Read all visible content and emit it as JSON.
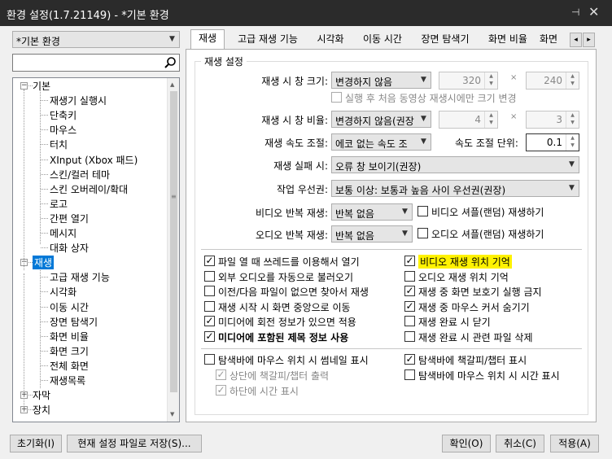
{
  "window": {
    "title": "환경 설정(1.7.21149) - *기본 환경",
    "pin_glyph": "⊣",
    "close_glyph": "✕"
  },
  "profile": {
    "selected": "*기본 환경"
  },
  "search": {
    "value": "",
    "placeholder": ""
  },
  "tree": {
    "items": [
      {
        "label": "기본",
        "level": 0,
        "expander": "−"
      },
      {
        "label": "재생기 실행시",
        "level": 1
      },
      {
        "label": "단축키",
        "level": 1
      },
      {
        "label": "마우스",
        "level": 1
      },
      {
        "label": "터치",
        "level": 1
      },
      {
        "label": "XInput (Xbox 패드)",
        "level": 1
      },
      {
        "label": "스킨/컬러 테마",
        "level": 1
      },
      {
        "label": "스킨 오버레이/확대",
        "level": 1
      },
      {
        "label": "로고",
        "level": 1
      },
      {
        "label": "간편 열기",
        "level": 1
      },
      {
        "label": "메시지",
        "level": 1
      },
      {
        "label": "대화 상자",
        "level": 1
      },
      {
        "label": "재생",
        "level": 0,
        "expander": "−",
        "selected": true
      },
      {
        "label": "고급 재생 기능",
        "level": 1
      },
      {
        "label": "시각화",
        "level": 1
      },
      {
        "label": "이동 시간",
        "level": 1
      },
      {
        "label": "장면 탐색기",
        "level": 1
      },
      {
        "label": "화면 비율",
        "level": 1
      },
      {
        "label": "화면 크기",
        "level": 1
      },
      {
        "label": "전체 화면",
        "level": 1
      },
      {
        "label": "재생목록",
        "level": 1
      },
      {
        "label": "자막",
        "level": 0,
        "expander": "+"
      },
      {
        "label": "장치",
        "level": 0,
        "expander": "+"
      }
    ]
  },
  "tabs": [
    "재생",
    "고급 재생 기능",
    "시각화",
    "이동 시간",
    "장면 탐색기",
    "화면 비율",
    "화면"
  ],
  "tab_scroll": {
    "left": "◂",
    "right": "▸"
  },
  "group": {
    "title": "재생 설정"
  },
  "settings": {
    "window_size_label": "재생 시 창 크기:",
    "window_size_value": "변경하지 않음",
    "width_value": "320",
    "height_value": "240",
    "times": "×",
    "first_only_label": "실행 후 처음 동영상 재생시에만 크기 변경",
    "ratio_label": "재생 시 창 비율:",
    "ratio_value": "변경하지 않음(권장",
    "ratio_w": "4",
    "ratio_h": "3",
    "speed_label": "재생 속도 조절:",
    "speed_value": "에코 없는 속도 조",
    "speed_unit_label": "속도 조절 단위:",
    "speed_unit_value": "0.1",
    "fail_label": "재생 실패 시:",
    "fail_value": "오류 창 보이기(권장)",
    "priority_label": "작업 우선권:",
    "priority_value": "보통 이상: 보통과 높음 사이 우선권(권장)",
    "video_repeat_label": "비디오 반복 재생:",
    "video_repeat_value": "반복 없음",
    "video_shuffle_label": "비디오 셔플(랜덤) 재생하기",
    "audio_repeat_label": "오디오 반복 재생:",
    "audio_repeat_value": "반복 없음",
    "audio_shuffle_label": "오디오 셔플(랜덤) 재생하기"
  },
  "options_left": [
    {
      "label": "파일 열 때 쓰레드를 이용해서 열기",
      "checked": true
    },
    {
      "label": "외부 오디오를 자동으로 불러오기",
      "checked": false
    },
    {
      "label": "이전/다음 파일이 없으면 찾아서 재생",
      "checked": false
    },
    {
      "label": "재생 시작 시 화면 중앙으로 이동",
      "checked": false
    },
    {
      "label": "미디어에 회전 정보가 있으면 적용",
      "checked": true
    },
    {
      "label": "미디어에 포함된 제목 정보 사용",
      "checked": true,
      "bold": true
    }
  ],
  "options_right": [
    {
      "label": "비디오 재생 위치 기억",
      "checked": true,
      "highlight": "#fff200"
    },
    {
      "label": "오디오 재생 위치 기억",
      "checked": false
    },
    {
      "label": "재생 중 화면 보호기 실행 금지",
      "checked": true
    },
    {
      "label": "재생 중 마우스 커서 숨기기",
      "checked": true
    },
    {
      "label": "재생 완료 시 닫기",
      "checked": false
    },
    {
      "label": "재생 완료 시 관련 파일 삭제",
      "checked": false
    }
  ],
  "seek": {
    "thumb_label": "탐색바에 마우스 위치 시 썸네일 표시",
    "bookmark_label": "탐색바에 책갈피/챕터 표시",
    "top_bookmark_label": "상단에 책갈피/챕터 출력",
    "time_label": "탐색바에 마우스 위치 시 시간 표시",
    "bottom_time_label": "하단에 시간 표시"
  },
  "footer": {
    "reset": "초기화(I)",
    "save": "현재 설정 파일로 저장(S)...",
    "ok": "확인(O)",
    "cancel": "취소(C)",
    "apply": "적용(A)"
  },
  "colors": {
    "accent": "#0078d7",
    "titlebar": "#2b2b2b",
    "highlight": "#fff200"
  },
  "icons": [
    "search-icon",
    "pin-icon",
    "close-icon",
    "chevron-down-icon"
  ]
}
